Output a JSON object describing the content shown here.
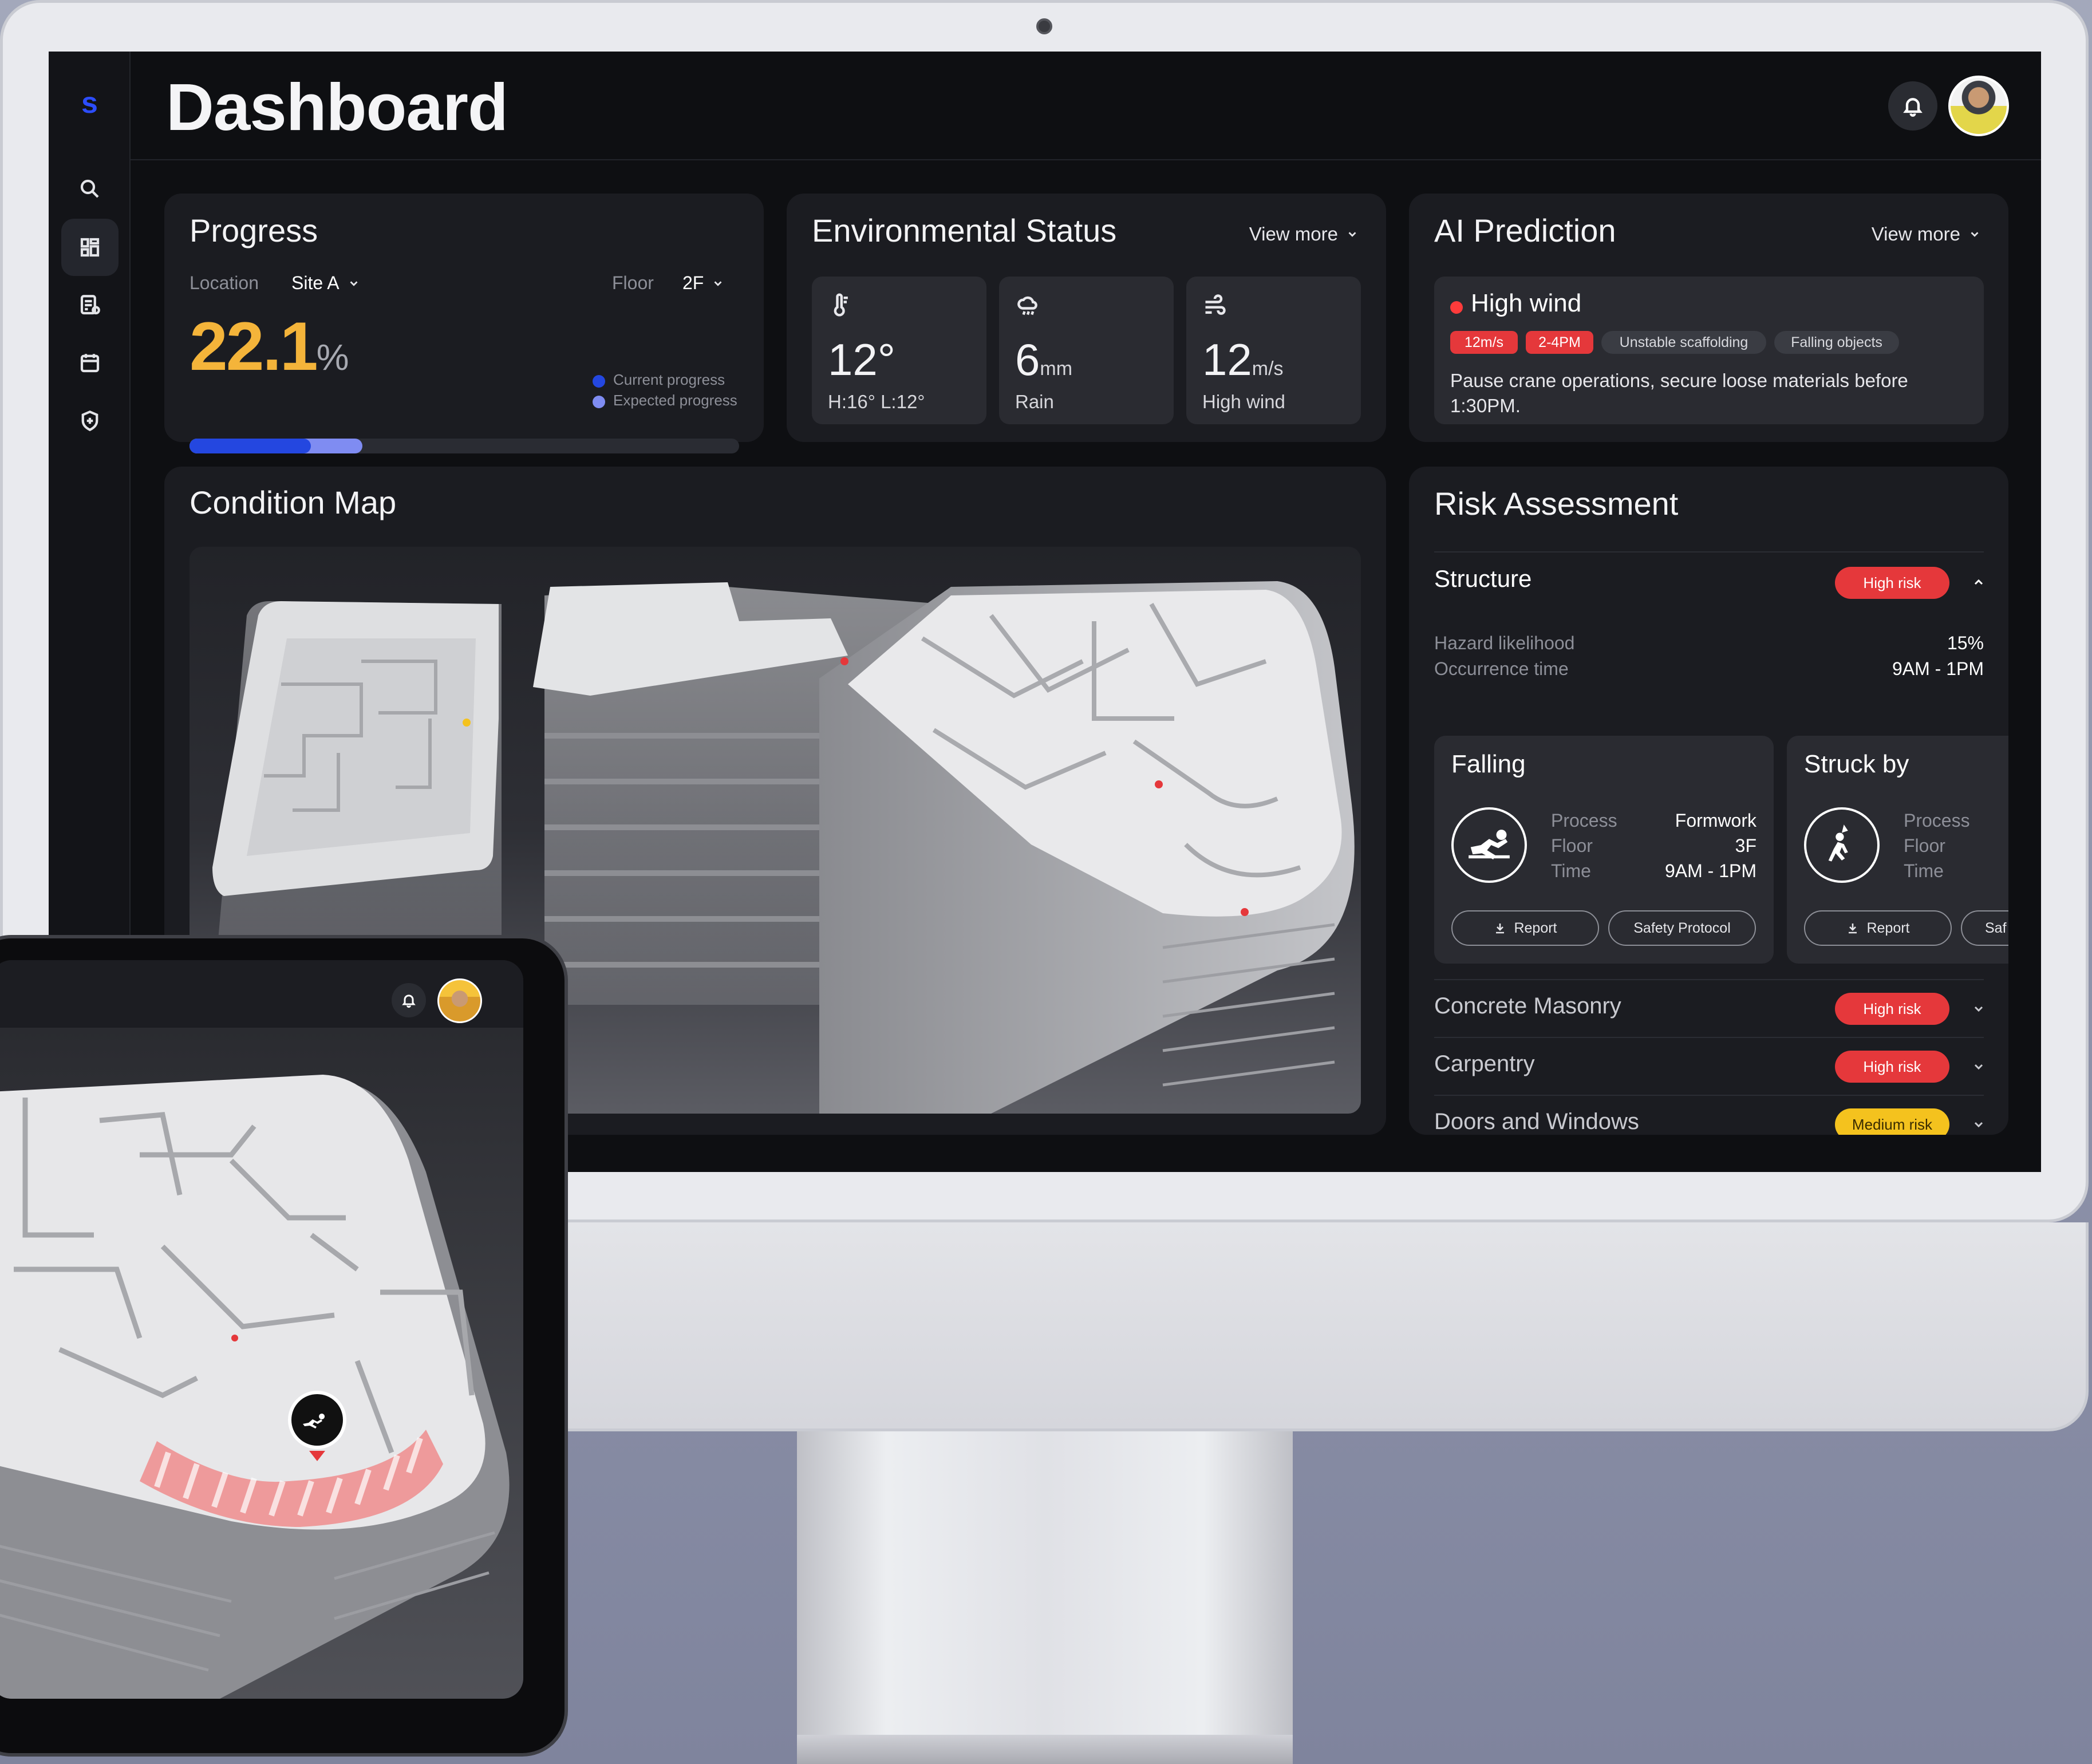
{
  "app": {
    "logo": "s",
    "title": "Dashboard"
  },
  "sidebar": {
    "items": [
      {
        "icon": "search-icon"
      },
      {
        "icon": "dashboard-grid-icon",
        "active": true
      },
      {
        "icon": "report-list-icon"
      },
      {
        "icon": "calendar-icon"
      },
      {
        "icon": "shield-plus-icon"
      }
    ]
  },
  "progress": {
    "title": "Progress",
    "location_label": "Location",
    "location_value": "Site A",
    "floor_label": "Floor",
    "floor_value": "2F",
    "percent": "22.1",
    "percent_unit": "%",
    "legend_current": "Current progress",
    "legend_expected": "Expected progress",
    "current_fraction": 0.221,
    "expected_fraction": 0.315,
    "colors": {
      "current": "#2447e0",
      "expected": "#7f8cf2",
      "percent": "#f4b43a"
    }
  },
  "environment": {
    "title": "Environmental Status",
    "view_more": "View more",
    "tiles": [
      {
        "icon": "thermometer-icon",
        "value": "12°",
        "unit": "",
        "sub": "H:16° L:12°"
      },
      {
        "icon": "rain-cloud-icon",
        "value": "6",
        "unit": "mm",
        "sub": "Rain"
      },
      {
        "icon": "wind-icon",
        "value": "12",
        "unit": "m/s",
        "sub": "High wind"
      }
    ]
  },
  "ai": {
    "title": "AI Prediction",
    "view_more": "View more",
    "alert_title": "High wind",
    "chips": [
      "12m/s",
      "2-4PM",
      "Unstable scaffolding",
      "Falling objects"
    ],
    "message": "Pause crane operations, secure loose materials before 1:30PM."
  },
  "map": {
    "title": "Condition Map"
  },
  "risk": {
    "title": "Risk Assessment",
    "structure": {
      "label": "Structure",
      "badge": "High risk",
      "hazard_label": "Hazard likelihood",
      "hazard_value": "15%",
      "time_label": "Occurrence time",
      "time_value": "9AM - 1PM"
    },
    "subcards": [
      {
        "title": "Falling",
        "icon": "falling-person-icon",
        "process_label": "Process",
        "process_value": "Formwork",
        "floor_label": "Floor",
        "floor_value": "3F",
        "time_label": "Time",
        "time_value": "9AM - 1PM",
        "report": "Report",
        "protocol": "Safety Protocol"
      },
      {
        "title": "Struck by",
        "icon": "struck-by-icon",
        "process_label": "Process",
        "floor_label": "Floor",
        "time_label": "Time",
        "report": "Report",
        "protocol": "Saf"
      }
    ],
    "accordion": [
      {
        "label": "Concrete Masonry",
        "badge": "High risk",
        "level": "high"
      },
      {
        "label": "Carpentry",
        "badge": "High risk",
        "level": "high"
      },
      {
        "label": "Doors and Windows",
        "badge": "Medium risk",
        "level": "medium"
      }
    ]
  }
}
